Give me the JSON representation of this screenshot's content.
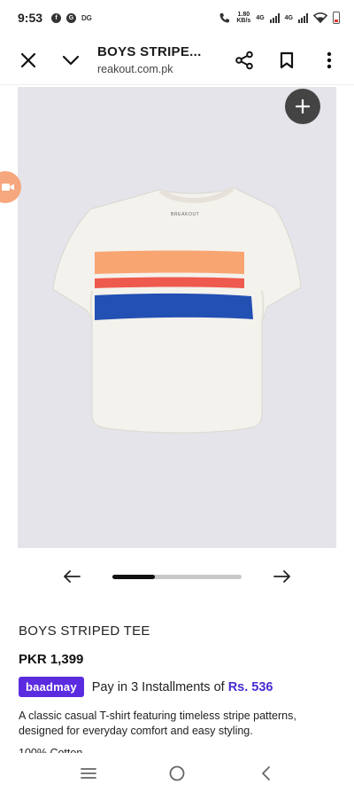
{
  "status_bar": {
    "time": "9:53",
    "icons": [
      "facebook-icon",
      "gc-icon",
      "dg-icon"
    ],
    "dg_label": "DG",
    "net_speed_value": "1.80",
    "net_speed_unit": "KB/s",
    "network_1": "4G",
    "network_2": "4G",
    "battery_color": "#e53935"
  },
  "browser": {
    "title": "BOYS STRIPE...",
    "domain": "reakout.com.pk"
  },
  "product_image": {
    "background": "#e4e4ea",
    "shirt_label": "BREAKOUT",
    "stripe_colors": [
      "#f9a572",
      "#ee5a4d",
      "#2350b3"
    ]
  },
  "carousel": {
    "progress_fraction": 0.33
  },
  "product": {
    "name": "BOYS STRIPED TEE",
    "price": "PKR 1,399",
    "installment_badge": "baadmay",
    "installment_text": "Pay in 3 Installments of ",
    "installment_amount": "Rs. 536",
    "description": "A classic casual T-shirt featuring timeless stripe patterns, designed for everyday comfort and easy styling.",
    "material": "100% Cotton"
  },
  "colors": {
    "accent": "#5b2be0",
    "fab": "#444444",
    "video_tab": "#f7a77d"
  }
}
